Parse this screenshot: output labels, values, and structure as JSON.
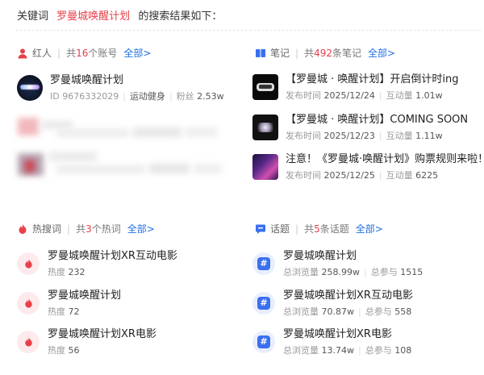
{
  "header": {
    "prefix": "关键词",
    "keyword": "罗曼城唤醒计划",
    "suffix": "的搜索结果如下："
  },
  "influencers": {
    "title": "红人",
    "count_prefix": "共",
    "count": "16",
    "count_suffix": "个账号",
    "all_label": "全部>",
    "items": [
      {
        "name": "罗曼城唤醒计划",
        "id_label": "ID",
        "id": "9676332029",
        "category": "运动健身",
        "fans_label": "粉丝",
        "fans": "2.53w"
      }
    ]
  },
  "notes": {
    "title": "笔记",
    "count_prefix": "共",
    "count": "492",
    "count_suffix": "条笔记",
    "all_label": "全部>",
    "items": [
      {
        "title": "【罗曼城 · 唤醒计划】开启倒计时ing",
        "time_label": "发布时间",
        "time": "2025/12/24",
        "eng_label": "互动量",
        "eng": "1.01w"
      },
      {
        "title": "【罗曼城 · 唤醒计划】COMING SOON",
        "time_label": "发布时间",
        "time": "2025/12/23",
        "eng_label": "互动量",
        "eng": "1.11w"
      },
      {
        "title": "注意！《罗曼城·唤醒计划》购票规则来啦！",
        "time_label": "发布时间",
        "time": "2025/12/25",
        "eng_label": "互动量",
        "eng": "6225"
      }
    ]
  },
  "hot_words": {
    "title": "热搜词",
    "count_prefix": "共",
    "count": "3",
    "count_suffix": "个热词",
    "all_label": "全部>",
    "items": [
      {
        "word": "罗曼城唤醒计划XR互动电影",
        "heat_label": "热度",
        "heat": "232"
      },
      {
        "word": "罗曼城唤醒计划",
        "heat_label": "热度",
        "heat": "72"
      },
      {
        "word": "罗曼城唤醒计划XR电影",
        "heat_label": "热度",
        "heat": "56"
      }
    ]
  },
  "topics": {
    "title": "话题",
    "count_prefix": "共",
    "count": "5",
    "count_suffix": "条话题",
    "all_label": "全部>",
    "items": [
      {
        "name": "罗曼城唤醒计划",
        "views_label": "总浏览量",
        "views": "258.99w",
        "part_label": "总参与",
        "part": "1515"
      },
      {
        "name": "罗曼城唤醒计划XR互动电影",
        "views_label": "总浏览量",
        "views": "70.87w",
        "part_label": "总参与",
        "part": "558"
      },
      {
        "name": "罗曼城唤醒计划XR电影",
        "views_label": "总浏览量",
        "views": "13.74w",
        "part_label": "总参与",
        "part": "108"
      }
    ]
  },
  "colors": {
    "accent_red": "#e6404a",
    "link_blue": "#1f6fe5",
    "topic_blue": "#3a6ff0"
  }
}
